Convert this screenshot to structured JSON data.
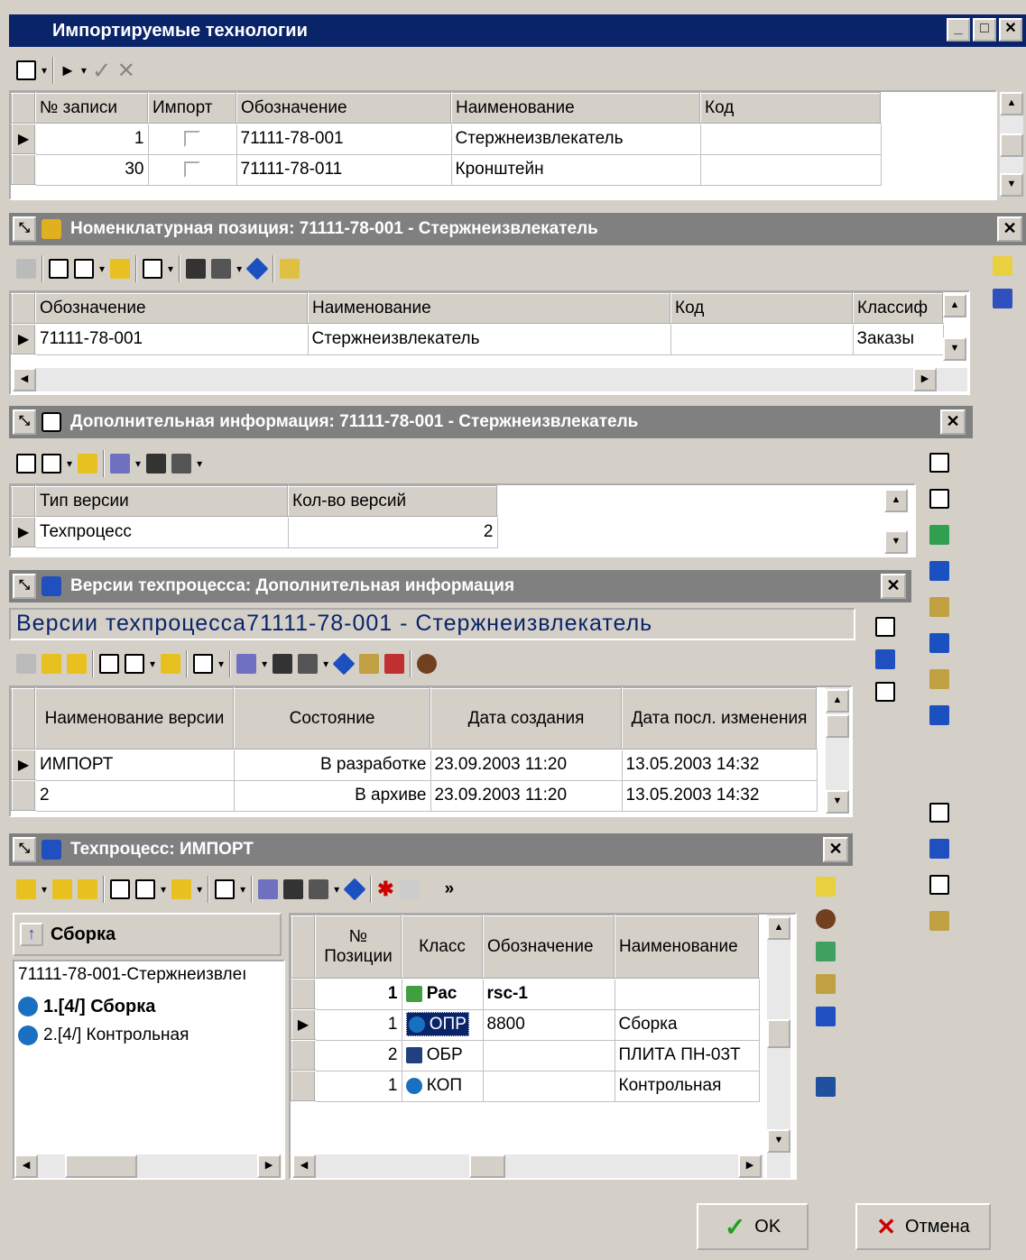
{
  "window": {
    "title": "Импортируемые технологии"
  },
  "window_buttons": {
    "minimize": "_",
    "maximize": "□",
    "close": "✕"
  },
  "imports": {
    "headers": [
      "№ записи",
      "Импорт",
      "Обозначение",
      "Наименование",
      "Код"
    ],
    "rows": [
      {
        "num": "1",
        "code": "71111-78-001",
        "name": "Стержнеизвлекатель",
        "kod": ""
      },
      {
        "num": "30",
        "code": "71111-78-011",
        "name": "Кронштейн",
        "kod": ""
      }
    ]
  },
  "nomenclature": {
    "title": "Номенклатурная позиция: 71111-78-001 - Стержнеизвлекатель",
    "headers": [
      "Обозначение",
      "Наименование",
      "Код",
      "Классиф"
    ],
    "rows": [
      {
        "code": "71111-78-001",
        "name": "Стержнеизвлекатель",
        "kod": "",
        "cls": "Заказы"
      }
    ]
  },
  "additional": {
    "title": "Дополнительная информация: 71111-78-001 - Стержнеизвлекатель",
    "headers": [
      "Тип версии",
      "Кол-во версий"
    ],
    "rows": [
      {
        "type": "Техпроцесс",
        "count": "2"
      }
    ]
  },
  "versions": {
    "title": "Версии техпроцесса: Дополнительная информация",
    "caption": "Версии техпроцесса71111-78-001 - Стержнеизвлекатель",
    "headers": [
      "Наименование версии",
      "Состояние",
      "Дата создания",
      "Дата посл. изменения"
    ],
    "rows": [
      {
        "name": "ИМПОРТ",
        "state": "В разработке",
        "created": "23.09.2003 11:20",
        "changed": "13.05.2003 14:32"
      },
      {
        "name": "2",
        "state": "В архиве",
        "created": "23.09.2003 11:20",
        "changed": "13.05.2003 14:32"
      }
    ]
  },
  "process": {
    "title": "Техпроцесс: ИМПОРТ",
    "tree_header": "Сборка",
    "tree": [
      "71111-78-001-Стержнеизвлеı",
      "1.[4/] Сборка",
      "2.[4/] Контрольная"
    ],
    "headers": [
      "№ Позиции",
      "Класс",
      "Обозначение",
      "Наименование"
    ],
    "rows": [
      {
        "pos": "1",
        "cls": "Рас",
        "code": "rsc-1",
        "name": "",
        "bold": true
      },
      {
        "pos": "1",
        "cls": "ОПР",
        "code": "8800",
        "name": "Сборка"
      },
      {
        "pos": "2",
        "cls": "ОБР",
        "code": "",
        "name": "ПЛИТА ПН-03Т"
      },
      {
        "pos": "1",
        "cls": "КОП",
        "code": "",
        "name": "Контрольная"
      }
    ]
  },
  "buttons": {
    "ok": "OK",
    "cancel": "Отмена"
  },
  "colors": {
    "titlebar": "#0a246a",
    "panelbar": "#808080",
    "face": "#d4d0c8"
  }
}
